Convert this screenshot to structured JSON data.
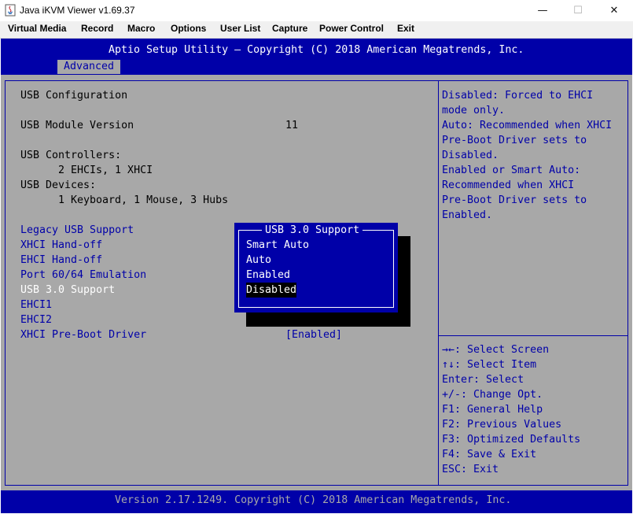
{
  "window": {
    "title": "Java iKVM Viewer v1.69.37",
    "minimize": "—",
    "maximize": "☐",
    "close": "✕"
  },
  "menubar": [
    "Virtual Media",
    "Record",
    "Macro",
    "Options",
    "User List",
    "Capture",
    "Power Control",
    "Exit"
  ],
  "bios": {
    "header_title": "Aptio Setup Utility – Copyright (C) 2018 American Megatrends, Inc.",
    "active_tab": "Advanced",
    "section_title": "USB Configuration",
    "module_version_label": "USB Module Version",
    "module_version_value": "11",
    "controllers_label": "USB Controllers:",
    "controllers_value": "2 EHCIs, 1 XHCI",
    "devices_label": "USB Devices:",
    "devices_value": "1 Keyboard, 1 Mouse, 3 Hubs",
    "settings": [
      {
        "label": "Legacy USB Support",
        "value": ""
      },
      {
        "label": "XHCI Hand-off",
        "value": ""
      },
      {
        "label": "EHCI Hand-off",
        "value": ""
      },
      {
        "label": "Port 60/64 Emulation",
        "value": ""
      },
      {
        "label": "USB 3.0 Support",
        "value": ""
      },
      {
        "label": "EHCI1",
        "value": ""
      },
      {
        "label": "EHCI2",
        "value": ""
      },
      {
        "label": "XHCI Pre-Boot Driver",
        "value": "[Enabled]"
      }
    ],
    "help_text": [
      "Disabled: Forced to EHCI",
      "mode only.",
      "Auto: Recommended when XHCI",
      "Pre-Boot Driver sets to",
      "Disabled.",
      "Enabled or Smart Auto:",
      "Recommended when XHCI",
      "Pre-Boot Driver sets to",
      "Enabled."
    ],
    "key_help": [
      "→←: Select Screen",
      "↑↓: Select Item",
      "Enter: Select",
      "+/-: Change Opt.",
      "F1: General Help",
      "F2: Previous Values",
      "F3: Optimized Defaults",
      "F4: Save & Exit",
      "ESC: Exit"
    ],
    "footer": "Version 2.17.1249. Copyright (C) 2018 American Megatrends, Inc."
  },
  "popup": {
    "title": "USB 3.0 Support",
    "options": [
      "Smart Auto",
      "Auto",
      "Enabled",
      "Disabled"
    ],
    "selected": "Disabled"
  }
}
